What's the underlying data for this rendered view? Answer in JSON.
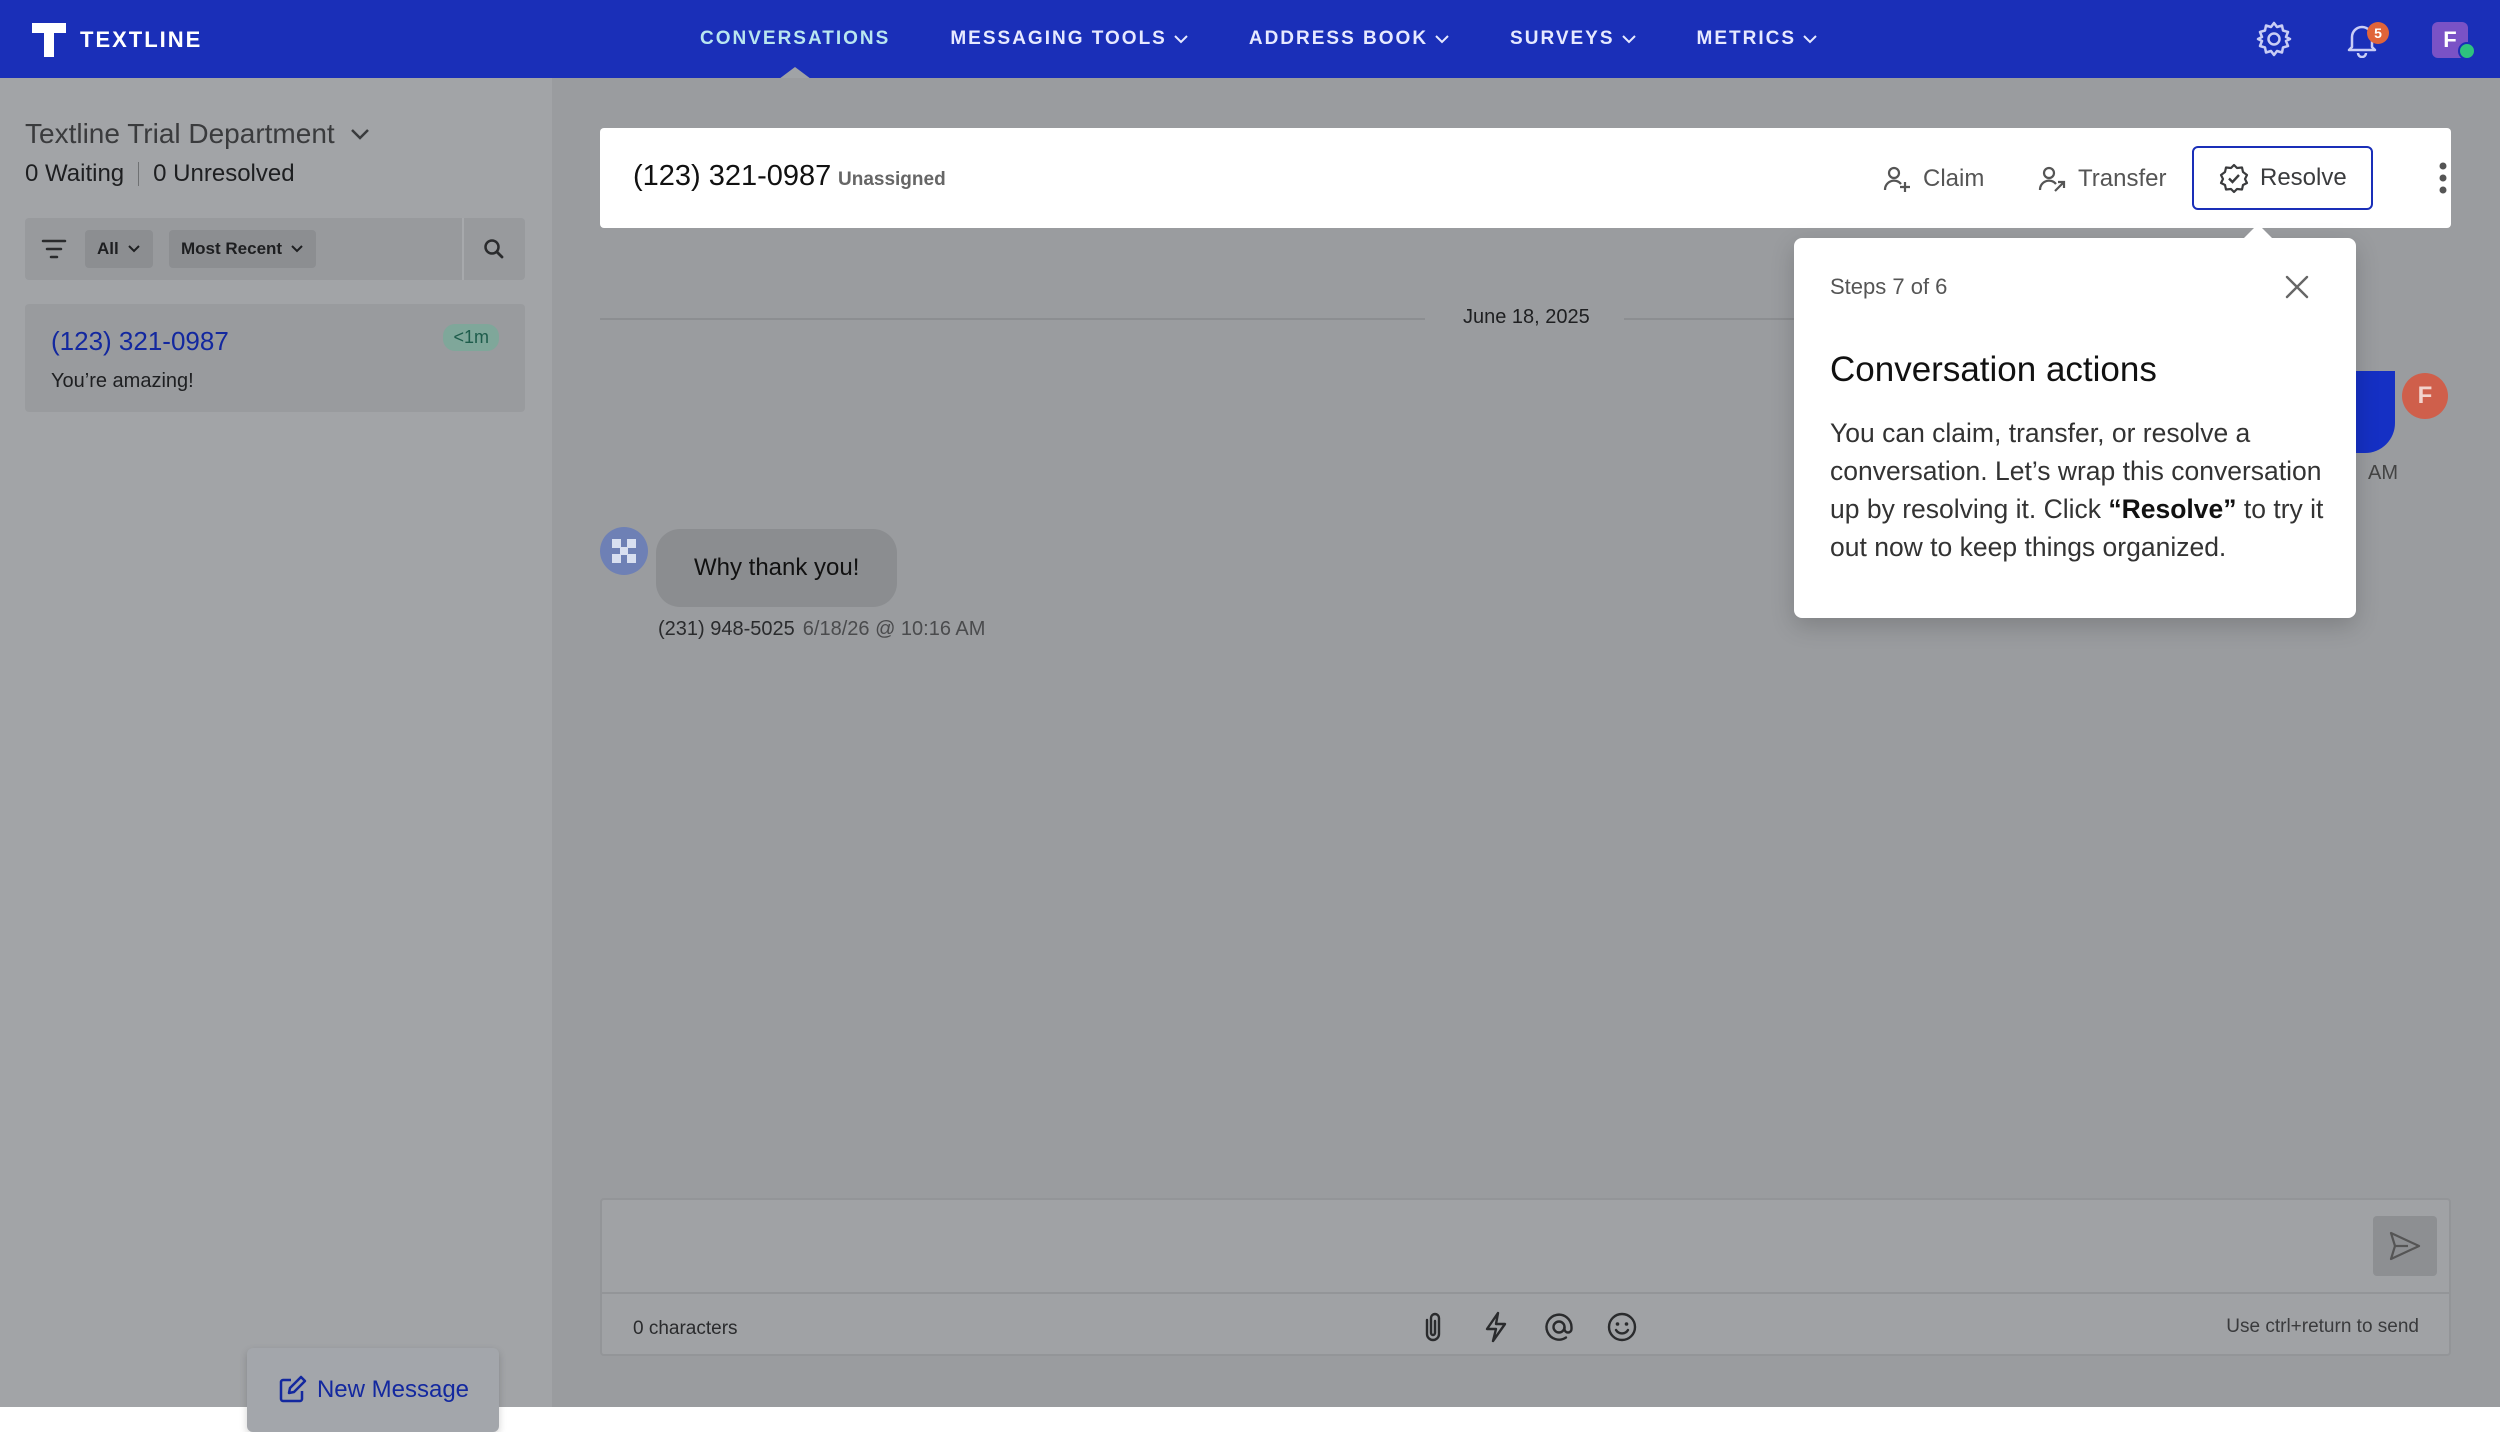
{
  "app": {
    "name": "TEXTLINE"
  },
  "nav": {
    "items": [
      {
        "label": "CONVERSATIONS",
        "active": true,
        "dropdown": false
      },
      {
        "label": "MESSAGING TOOLS",
        "active": false,
        "dropdown": true
      },
      {
        "label": "ADDRESS BOOK",
        "active": false,
        "dropdown": true
      },
      {
        "label": "SURVEYS",
        "active": false,
        "dropdown": true
      },
      {
        "label": "METRICS",
        "active": false,
        "dropdown": true
      }
    ],
    "notification_count": "5",
    "avatar_initial": "F"
  },
  "sidebar": {
    "department": "Textline Trial Department",
    "waiting": "0 Waiting",
    "unresolved": "0 Unresolved",
    "filter_all": "All",
    "filter_sort": "Most Recent",
    "conversations": [
      {
        "phone": "(123) 321-0987",
        "preview": "You’re amazing!",
        "time": "<1m"
      }
    ],
    "new_message_label": "New Message"
  },
  "conversation": {
    "phone": "(123) 321-0987",
    "status": "Unassigned",
    "actions": {
      "claim": "Claim",
      "transfer": "Transfer",
      "resolve": "Resolve"
    },
    "date_divider": "June 18, 2025",
    "outgoing": {
      "avatar_initial": "F",
      "meta_partial": "AM"
    },
    "incoming": {
      "text": "Why thank you!",
      "sender": "(231) 948-5025",
      "timestamp": "6/18/26 @ 10:16 AM"
    }
  },
  "composer": {
    "char_count": "0 characters",
    "send_hint": "Use ctrl+return to send"
  },
  "popover": {
    "step": "Steps 7 of 6",
    "title": "Conversation actions",
    "body_before": "You can claim, transfer, or resolve a conversation. Let’s wrap this conversation up by resolving it. Click ",
    "body_bold": "“Resolve”",
    "body_after": " to try it out now to keep things organized."
  },
  "colors": {
    "nav_bg": "#1a2fb8",
    "accent": "#1a2fb8",
    "link": "#13289f",
    "badge": "#e0643a",
    "overlay": "#9a9c9f"
  }
}
